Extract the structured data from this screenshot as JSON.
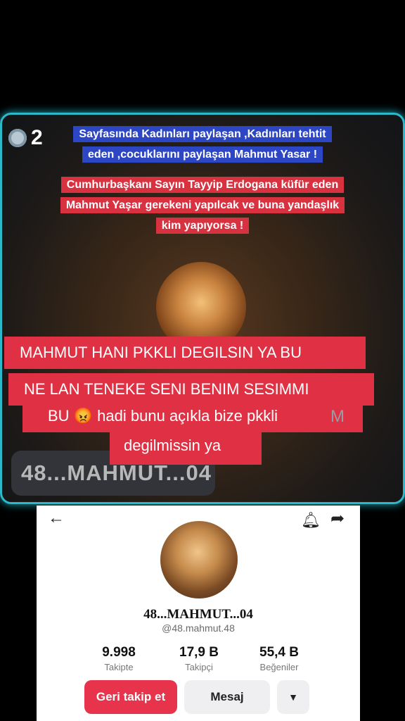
{
  "video": {
    "viewer_count": "2",
    "caption_blue": "Sayfasında Kadınları paylaşan ,Kadınları tehtit eden ,cocuklarını paylaşan Mahmut Yasar !",
    "caption_red": "Cumhurbaşkanı Sayın Tayyip Erdogana küfür eden Mahmut Yaşar gerekeni yapılcak ve buna yandaşlık kim yapıyorsa !",
    "handle_pill": "48...MAHMUT...04"
  },
  "overlay": {
    "line1": "MAHMUT HANI PKKLI DEGILSIN YA BU",
    "line2": "NE LAN TENEKE SENI BENIM SESIMMI",
    "line3": "BU 😡 hadi bunu açıkla bize pkkli",
    "line4": "degilmissin ya",
    "ghost_letter": "M"
  },
  "profile": {
    "display_name": "48...MAHMUT...04",
    "username": "@48.mahmut.48",
    "stats": [
      {
        "value": "9.998",
        "label": "Takipte"
      },
      {
        "value": "17,9 B",
        "label": "Takipçi"
      },
      {
        "value": "55,4 B",
        "label": "Beğeniler"
      }
    ],
    "follow_back_label": "Geri takip et",
    "message_label": "Mesaj",
    "more_symbol": "▼"
  },
  "icons": {
    "back": "←",
    "bell": "🔔︎",
    "share": "➦"
  },
  "colors": {
    "panel_border": "#2bb9c9",
    "caption_blue": "#2d46c4",
    "caption_red": "#d8313f",
    "overlay_red": "#e03144",
    "follow_button": "#e8334c"
  }
}
